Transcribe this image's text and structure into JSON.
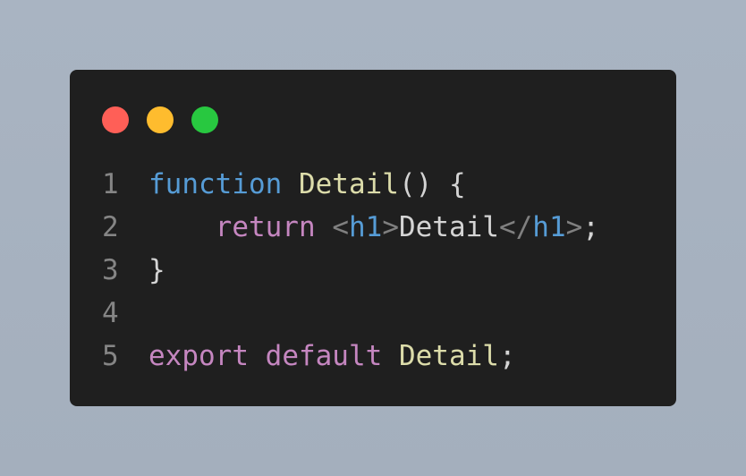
{
  "window": {
    "dots": {
      "red": "#ff5f57",
      "yellow": "#febc2e",
      "green": "#28c840"
    }
  },
  "colors": {
    "background": "#1f1f1f",
    "keyword_blue": "#569cd6",
    "keyword_purple": "#c586c0",
    "function_name": "#dcdcaa",
    "punctuation": "#d4d4d4",
    "line_number": "#858585"
  },
  "code": {
    "lines": [
      {
        "number": "1",
        "tokens": [
          {
            "text": "function",
            "kind": "kw-blue"
          },
          {
            "text": " ",
            "kind": "text"
          },
          {
            "text": "Detail",
            "kind": "fn"
          },
          {
            "text": "() {",
            "kind": "punc"
          }
        ]
      },
      {
        "number": "2",
        "tokens": [
          {
            "text": "    ",
            "kind": "text"
          },
          {
            "text": "return",
            "kind": "kw-purple"
          },
          {
            "text": " ",
            "kind": "text"
          },
          {
            "text": "<",
            "kind": "tag-bracket"
          },
          {
            "text": "h1",
            "kind": "tag"
          },
          {
            "text": ">",
            "kind": "tag-bracket"
          },
          {
            "text": "Detail",
            "kind": "text"
          },
          {
            "text": "</",
            "kind": "tag-bracket"
          },
          {
            "text": "h1",
            "kind": "tag"
          },
          {
            "text": ">",
            "kind": "tag-bracket"
          },
          {
            "text": ";",
            "kind": "punc"
          }
        ]
      },
      {
        "number": "3",
        "tokens": [
          {
            "text": "}",
            "kind": "punc"
          }
        ]
      },
      {
        "number": "4",
        "tokens": []
      },
      {
        "number": "5",
        "tokens": [
          {
            "text": "export",
            "kind": "kw-purple"
          },
          {
            "text": " ",
            "kind": "text"
          },
          {
            "text": "default",
            "kind": "kw-purple"
          },
          {
            "text": " ",
            "kind": "text"
          },
          {
            "text": "Detail",
            "kind": "fn"
          },
          {
            "text": ";",
            "kind": "punc"
          }
        ]
      }
    ]
  }
}
